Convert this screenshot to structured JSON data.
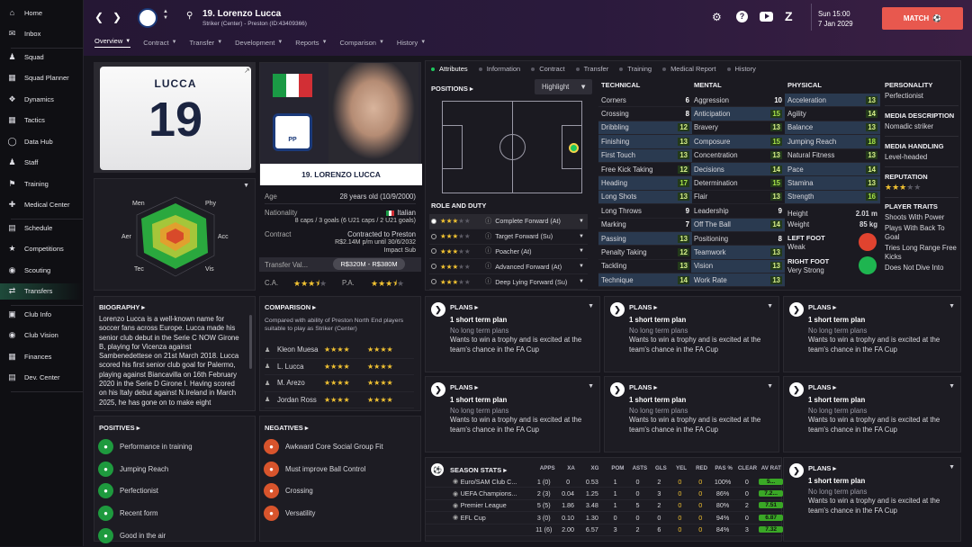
{
  "sidebar": {
    "items": [
      {
        "label": "Home",
        "icon": "home-icon"
      },
      {
        "label": "Inbox",
        "icon": "inbox-icon"
      },
      {
        "label": "Squad",
        "icon": "squad-icon"
      },
      {
        "label": "Squad Planner",
        "icon": "planner-icon"
      },
      {
        "label": "Dynamics",
        "icon": "dynamics-icon"
      },
      {
        "label": "Tactics",
        "icon": "tactics-icon"
      },
      {
        "label": "Data Hub",
        "icon": "datahub-icon"
      },
      {
        "label": "Staff",
        "icon": "staff-icon"
      },
      {
        "label": "Training",
        "icon": "training-icon"
      },
      {
        "label": "Medical Center",
        "icon": "medical-icon"
      },
      {
        "label": "Schedule",
        "icon": "schedule-icon"
      },
      {
        "label": "Competitions",
        "icon": "trophy-icon"
      },
      {
        "label": "Scouting",
        "icon": "scouting-icon"
      },
      {
        "label": "Transfers",
        "icon": "transfers-icon"
      },
      {
        "label": "Club Info",
        "icon": "clubinfo-icon"
      },
      {
        "label": "Club Vision",
        "icon": "vision-icon"
      },
      {
        "label": "Finances",
        "icon": "finances-icon"
      },
      {
        "label": "Dev. Center",
        "icon": "dev-icon"
      }
    ]
  },
  "topbar": {
    "player_title": "19. Lorenzo Lucca",
    "player_sub": "Striker (Center) - Preston (ID:43409366)",
    "date_day": "Sun 15:00",
    "date": "7 Jan 2029",
    "match_label": "MATCH",
    "tabs": [
      "Overview",
      "Contract",
      "Transfer",
      "Development",
      "Reports",
      "Comparison",
      "History"
    ]
  },
  "card": {
    "name": "LUCCA",
    "number": "19",
    "caption": "19. LORENZO LUCCA"
  },
  "info": {
    "age_label": "Age",
    "age": "28 years old (10/9/2000)",
    "nat_label": "Nationality",
    "nat": "Italian",
    "caps": "8 caps / 3 goals (6 U21 caps / 2 U21 goals)",
    "contract_label": "Contract",
    "contract1": "Contracted to Preston",
    "contract2": "R$2.14M p/m until 30/6/2032",
    "contract3": "Impact Sub",
    "tv_label": "Transfer Val...",
    "tv": "R$320M - R$380M",
    "ca_label": "C.A.",
    "pa_label": "P.A."
  },
  "radar": {
    "labels": [
      "Men",
      "Phy",
      "Acc",
      "Vis",
      "Tec",
      "Aer"
    ]
  },
  "attr_tabs": [
    "Attributes",
    "Information",
    "Contract",
    "Transfer",
    "Training",
    "Medical Report",
    "History"
  ],
  "positions": {
    "title": "POSITIONS",
    "highlight": "Highlight",
    "role_title": "ROLE AND DUTY",
    "roles": [
      {
        "name": "Complete Forward (At)",
        "stars": 3
      },
      {
        "name": "Target Forward (Su)",
        "stars": 3
      },
      {
        "name": "Poacher (At)",
        "stars": 3
      },
      {
        "name": "Advanced Forward (At)",
        "stars": 3
      },
      {
        "name": "Deep Lying Forward (Su)",
        "stars": 3
      }
    ]
  },
  "technical": {
    "title": "TECHNICAL",
    "rows": [
      [
        "Corners",
        "6",
        ""
      ],
      [
        "Crossing",
        "8",
        ""
      ],
      [
        "Dribbling",
        "12",
        "hl"
      ],
      [
        "Finishing",
        "13",
        "hl"
      ],
      [
        "First Touch",
        "13",
        "hl"
      ],
      [
        "Free Kick Taking",
        "12",
        ""
      ],
      [
        "Heading",
        "17",
        "hl"
      ],
      [
        "Long Shots",
        "13",
        "hl"
      ],
      [
        "Long Throws",
        "9",
        ""
      ],
      [
        "Marking",
        "7",
        ""
      ],
      [
        "Passing",
        "13",
        "hl"
      ],
      [
        "Penalty Taking",
        "12",
        ""
      ],
      [
        "Tackling",
        "13",
        ""
      ],
      [
        "Technique",
        "14",
        "hl"
      ]
    ]
  },
  "mental": {
    "title": "MENTAL",
    "rows": [
      [
        "Aggression",
        "10",
        ""
      ],
      [
        "Anticipation",
        "15",
        "hl"
      ],
      [
        "Bravery",
        "13",
        ""
      ],
      [
        "Composure",
        "15",
        "hl"
      ],
      [
        "Concentration",
        "13",
        ""
      ],
      [
        "Decisions",
        "14",
        "hl"
      ],
      [
        "Determination",
        "15",
        ""
      ],
      [
        "Flair",
        "13",
        ""
      ],
      [
        "Leadership",
        "9",
        ""
      ],
      [
        "Off The Ball",
        "14",
        "hl"
      ],
      [
        "Positioning",
        "8",
        ""
      ],
      [
        "Teamwork",
        "13",
        "hl"
      ],
      [
        "Vision",
        "13",
        "hl"
      ],
      [
        "Work Rate",
        "13",
        "hl"
      ]
    ]
  },
  "physical": {
    "title": "PHYSICAL",
    "rows": [
      [
        "Acceleration",
        "13",
        "hl"
      ],
      [
        "Agility",
        "14",
        ""
      ],
      [
        "Balance",
        "13",
        "hl"
      ],
      [
        "Jumping Reach",
        "18",
        "hl"
      ],
      [
        "Natural Fitness",
        "13",
        ""
      ],
      [
        "Pace",
        "14",
        "hl"
      ],
      [
        "Stamina",
        "13",
        "hl"
      ],
      [
        "Strength",
        "16",
        "hl"
      ]
    ],
    "height_label": "Height",
    "height": "2.01 m",
    "weight_label": "Weight",
    "weight": "85 kg",
    "lf_label": "LEFT FOOT",
    "lf": "Weak",
    "rf_label": "RIGHT FOOT",
    "rf": "Very Strong"
  },
  "personality": {
    "title": "PERSONALITY",
    "value": "Perfectionist",
    "media_title": "MEDIA DESCRIPTION",
    "media": "Nomadic striker",
    "mh_title": "MEDIA HANDLING",
    "mh": "Level-headed",
    "rep_title": "REPUTATION",
    "traits_title": "PLAYER TRAITS",
    "traits": [
      "Shoots With Power",
      "Plays With Back To Goal",
      "Tries Long Range Free Kicks",
      "Does Not Dive Into"
    ]
  },
  "bio": {
    "title": "BIOGRAPHY",
    "text": "Lorenzo Lucca is a well-known name for soccer fans across Europe. Lucca made his senior club debut in the Serie C NOW Girone B, playing for Vicenza against Sambenedettese on 21st March 2018. Lucca scored his first senior club goal for Palermo, playing against Biancavilla on 16th February 2020 in the Serie D Girone I. Having scored on his Italy debut against N.Ireland in March 2025, he has gone on to make eight"
  },
  "comparison": {
    "title": "COMPARISON",
    "desc": "Compared with ability of Preston North End players suitable to play as Striker (Center)",
    "rows": [
      "Kleon Muesa",
      "L. Lucca",
      "M. Arezo",
      "Jordan Ross"
    ]
  },
  "positives": {
    "title": "POSITIVES",
    "items": [
      "Performance in training",
      "Jumping Reach",
      "Perfectionist",
      "Recent form",
      "Good in the air"
    ]
  },
  "negatives": {
    "title": "NEGATIVES",
    "items": [
      "Awkward Core Social Group Fit",
      "Must improve Ball Control",
      "Crossing",
      "Versatility"
    ]
  },
  "plan": {
    "title": "PLANS",
    "short": "1 short term plan",
    "long": "No long term plans",
    "text": "Wants to win a trophy and is excited at the team's chance in the FA Cup"
  },
  "season": {
    "title": "SEASON STATS",
    "cols": [
      "APPS",
      "XA",
      "XG",
      "POM",
      "ASTS",
      "GLS",
      "YEL",
      "RED",
      "PAS %",
      "CLEAR",
      "AV RAT"
    ],
    "rows": [
      [
        "Euro/SAM Club C...",
        "1 (0)",
        "0",
        "0.53",
        "1",
        "0",
        "2",
        "0",
        "0",
        "100%",
        "0",
        "5..."
      ],
      [
        "UEFA Champions...",
        "2 (3)",
        "0.04",
        "1.25",
        "1",
        "0",
        "3",
        "0",
        "0",
        "86%",
        "0",
        "7.2..."
      ],
      [
        "Premier League",
        "5 (5)",
        "1.86",
        "3.48",
        "1",
        "5",
        "2",
        "0",
        "0",
        "80%",
        "2",
        "7.51"
      ],
      [
        "EFL Cup",
        "3 (0)",
        "0.10",
        "1.30",
        "0",
        "0",
        "0",
        "0",
        "0",
        "94%",
        "0",
        "6.87"
      ],
      [
        "",
        "11 (6)",
        "2.00",
        "6.57",
        "3",
        "2",
        "6",
        "0",
        "0",
        "84%",
        "3",
        "7.32"
      ]
    ]
  }
}
